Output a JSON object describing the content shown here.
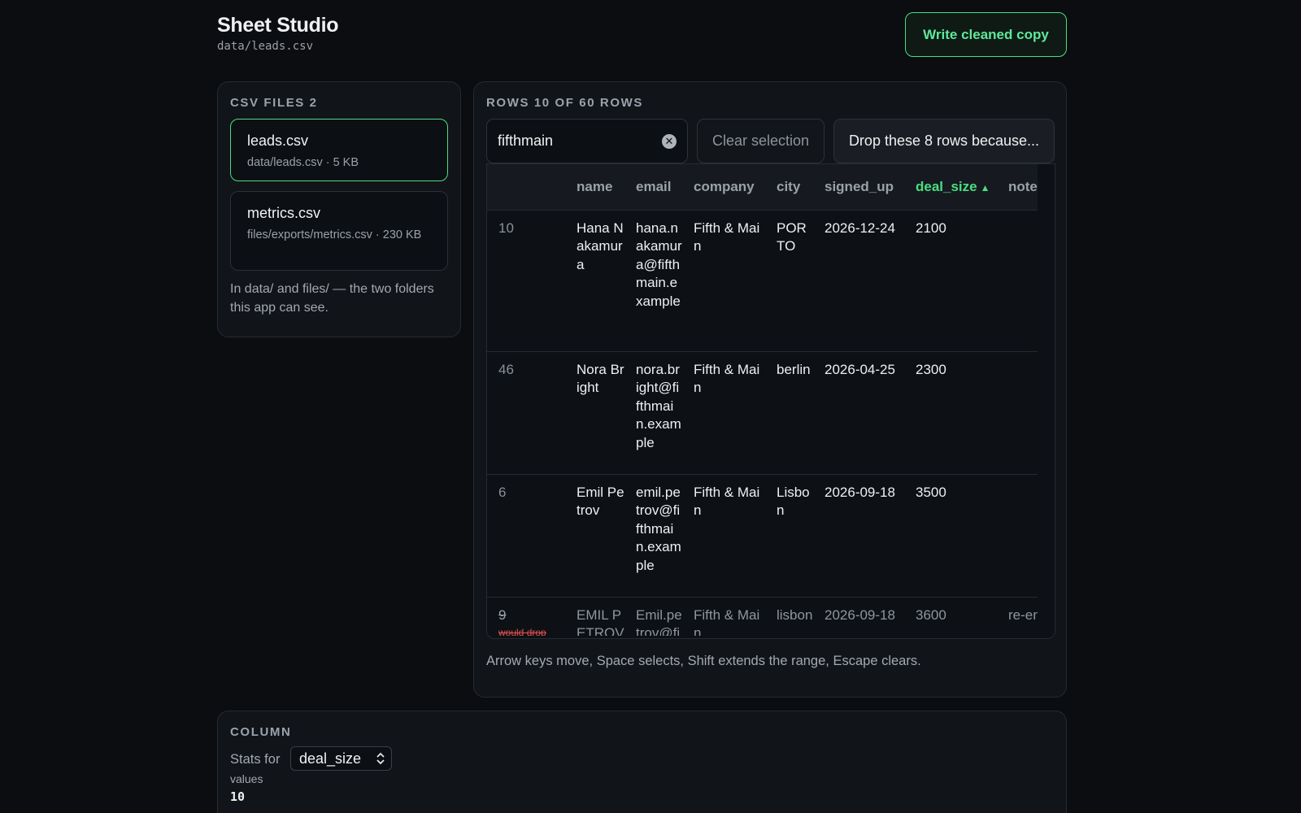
{
  "header": {
    "title": "Sheet Studio",
    "path": "data/leads.csv",
    "write_button": "Write cleaned copy"
  },
  "files": {
    "section_label": "CSV FILES 2",
    "items": [
      {
        "name": "leads.csv",
        "meta": "data/leads.csv · 5 KB",
        "active": true
      },
      {
        "name": "metrics.csv",
        "meta": "files/exports/metrics.csv · 230 KB",
        "active": false
      }
    ],
    "note": "In data/ and files/ — the two folders this app can see."
  },
  "rows": {
    "section_label": "ROWS 10 OF 60 ROWS",
    "search": {
      "value": "fifthmain",
      "placeholder": ""
    },
    "clear_selection": "Clear selection",
    "drop_button": "Drop these 8 rows because...",
    "columns": [
      "",
      "name",
      "email",
      "company",
      "city",
      "signed_up",
      "deal_size",
      "notes"
    ],
    "sorted_column": "deal_size",
    "sort_direction": "ascending",
    "data": [
      [
        "10",
        "Hana Nakamura",
        "hana.nakamura@fifthmain.example",
        "Fifth & Main",
        "PORTO",
        "2026-12-24",
        "2100",
        ""
      ],
      [
        "46",
        "Nora Bright",
        "nora.bright@fifthmain.example",
        "Fifth & Main",
        "berlin",
        "2026-04-25",
        "2300",
        ""
      ],
      [
        "6",
        "Emil Petrov",
        "emil.petrov@fifthmain.example",
        "Fifth & Main",
        "Lisbon",
        "2026-09-18",
        "3500",
        ""
      ],
      [
        "9",
        "EMIL PETROV",
        "Emil.petrov@fifthmain.example",
        "Fifth & Main",
        "lisbon",
        "2026-09-18",
        "3600",
        "re-entered"
      ]
    ],
    "drop_tag": "would drop",
    "hint": "Arrow keys move, Space selects, Shift extends the range, Escape clears."
  },
  "column": {
    "section_label": "COLUMN",
    "stats_for": "Stats for",
    "selected": "deal_size",
    "values_label": "values",
    "values_count": "10"
  },
  "colors": {
    "accent": "#4ade80",
    "background": "#0b0d10",
    "panel": "#111419",
    "danger": "#e05252"
  }
}
